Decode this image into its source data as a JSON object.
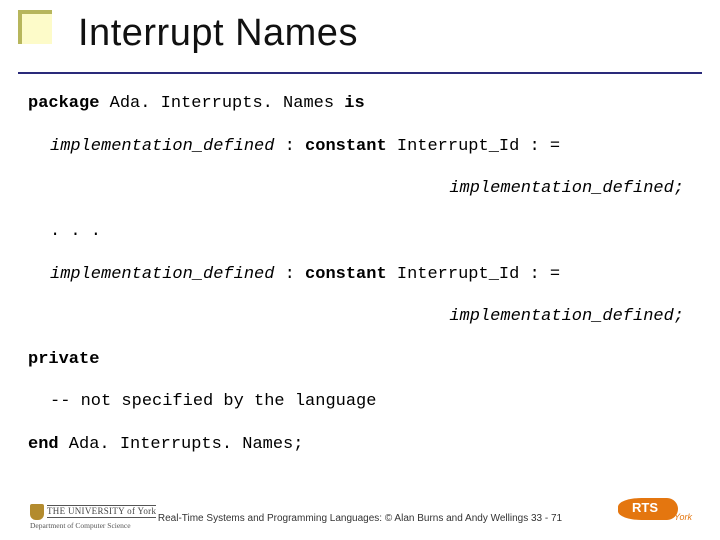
{
  "title": "Interrupt Names",
  "code": {
    "l1_kw1": "package",
    "l1_rest": " Ada. Interrupts. Names ",
    "l1_kw2": "is",
    "decl_impl": "implementation_defined",
    "decl_colon": " : ",
    "decl_kw": "constant",
    "decl_rest": " Interrupt_Id : =",
    "rhs": "implementation_defined;",
    "dots": ". . .",
    "priv": "private",
    "comment": "-- not specified by the language",
    "end_kw": "end",
    "end_rest": " Ada. Interrupts. Names;"
  },
  "footer": {
    "uni_top": "THE UNIVERSITY of York",
    "uni_sub": "Department of Computer Science",
    "text": "Real-Time Systems and Programming Languages: © Alan Burns and Andy Wellings 33 - 71",
    "rts": "RTS",
    "rts_sub": "York"
  }
}
